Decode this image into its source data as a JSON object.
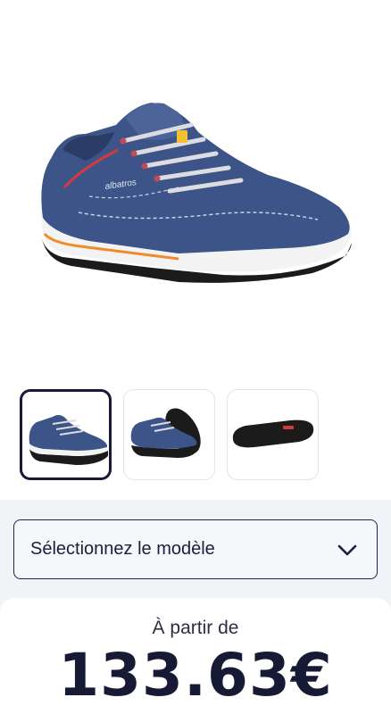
{
  "product": {
    "image_alt_icon": "safety-sneaker-image",
    "shoe_brand_text": "albatros",
    "colors": {
      "upper": "#3c5487",
      "sole": "#1b1b1b",
      "midsole": "#f3f3f3",
      "accent_orange": "#f08a2a",
      "accent_red": "#d83a3a"
    }
  },
  "gallery": {
    "thumbnails": [
      {
        "name": "side-view"
      },
      {
        "name": "pair-view"
      },
      {
        "name": "sole-view"
      }
    ],
    "selected_index": 0
  },
  "model_select": {
    "label": "Sélectionnez le modèle",
    "icon": "chevron-down-icon"
  },
  "pricing": {
    "from_label": "À partir de",
    "price": "133.63€"
  }
}
